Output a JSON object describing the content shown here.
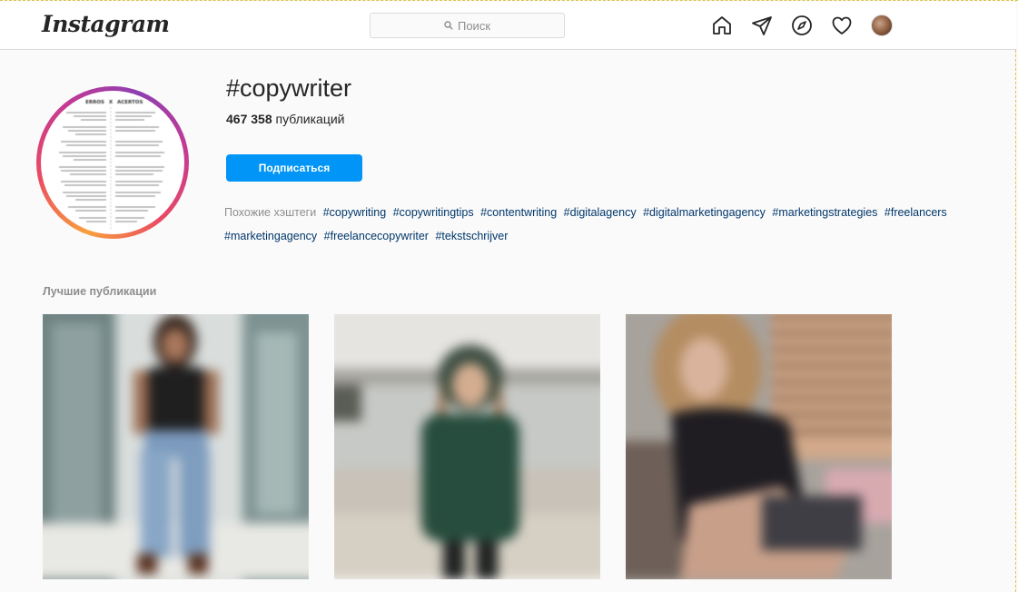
{
  "header": {
    "logo": "Instagram",
    "search_placeholder": "Поиск",
    "icons": [
      "home-icon",
      "direct-icon",
      "explore-icon",
      "activity-icon",
      "profile-avatar"
    ]
  },
  "tag": {
    "title": "#copywriter",
    "posts_count": "467 358",
    "posts_label": "публикаций",
    "follow_label": "Подписаться",
    "related_label": "Похожие хэштеги",
    "related": [
      "#copywriting",
      "#copywritingtips",
      "#contentwriting",
      "#digitalagency",
      "#digitalmarketingagency",
      "#marketingstrategies",
      "#freelancers",
      "#marketingagency",
      "#freelancecopywriter",
      "#tekstschrijver"
    ],
    "avatar_columns": [
      "ERROS",
      "X",
      "ACERTOS"
    ]
  },
  "top_posts": {
    "title": "Лучшие публикации"
  },
  "colors": {
    "accent": "#0095f6",
    "link": "#00376b",
    "muted": "#8e8e8e",
    "border": "#dbdbdb"
  }
}
